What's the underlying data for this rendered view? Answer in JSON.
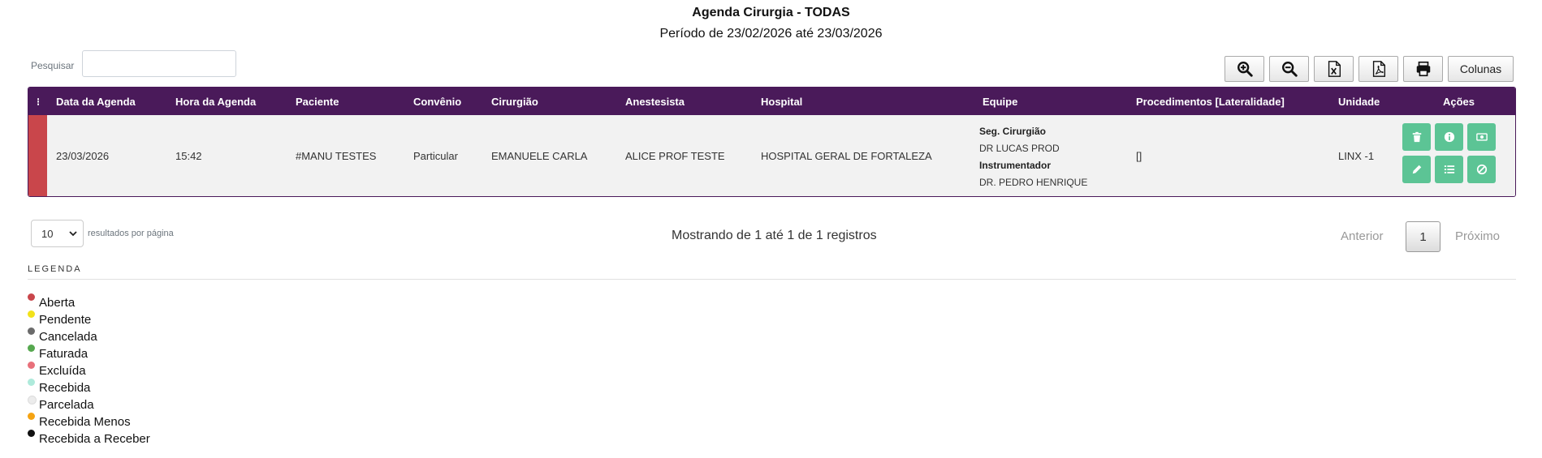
{
  "header": {
    "title": "Agenda Cirurgia - TODAS",
    "subtitle": "Período de 23/02/2026 até 23/03/2026"
  },
  "search": {
    "label": "Pesquisar",
    "value": ""
  },
  "toolbar": {
    "icons": [
      "zoom-in-icon",
      "zoom-out-icon",
      "excel-icon",
      "pdf-icon",
      "print-icon"
    ],
    "columns_label": "Colunas"
  },
  "table": {
    "columns": [
      "Data da Agenda",
      "Hora da Agenda",
      "Paciente",
      "Convênio",
      "Cirurgião",
      "Anestesista",
      "Hospital",
      "Equipe",
      "Procedimentos [Lateralidade]",
      "Unidade",
      "Ações"
    ],
    "rows": [
      {
        "status_color": "#c9464b",
        "date": "23/03/2026",
        "time": "15:42",
        "patient": "#MANU TESTES",
        "insurance": "Particular",
        "surgeon": "EMANUELE CARLA",
        "anesthetist": "ALICE PROF TESTE",
        "hospital": "HOSPITAL GERAL DE FORTALEZA",
        "team": {
          "role1": "Seg. Cirurgião",
          "name1": "DR LUCAS PROD",
          "role2": "Instrumentador",
          "name2": "DR. PEDRO HENRIQUE"
        },
        "procedures": "[]",
        "unit": "LINX -1",
        "actions": [
          "trash-icon",
          "info-icon",
          "money-icon",
          "edit-icon",
          "list-icon",
          "ban-icon"
        ]
      }
    ]
  },
  "pagination": {
    "per_page": "10",
    "per_page_label": "resultados por página",
    "info": "Mostrando de 1 até 1 de 1 registros",
    "prev": "Anterior",
    "current": "1",
    "next": "Próximo"
  },
  "legend": {
    "title": "LEGENDA",
    "items": [
      {
        "label": "Aberta",
        "color": "#c9464b"
      },
      {
        "label": "Pendente",
        "color": "#f2e21a"
      },
      {
        "label": "Cancelada",
        "color": "#6b6b6b"
      },
      {
        "label": "Faturada",
        "color": "#56a84f"
      },
      {
        "label": "Excluída",
        "color": "#e8707a"
      },
      {
        "label": "Recebida",
        "color": "#aeeadb"
      },
      {
        "label": "Parcelada",
        "color": "#ececec"
      },
      {
        "label": "Recebida Menos",
        "color": "#f5a312"
      },
      {
        "label": "Recebida a Receber",
        "color": "#111111"
      }
    ]
  }
}
